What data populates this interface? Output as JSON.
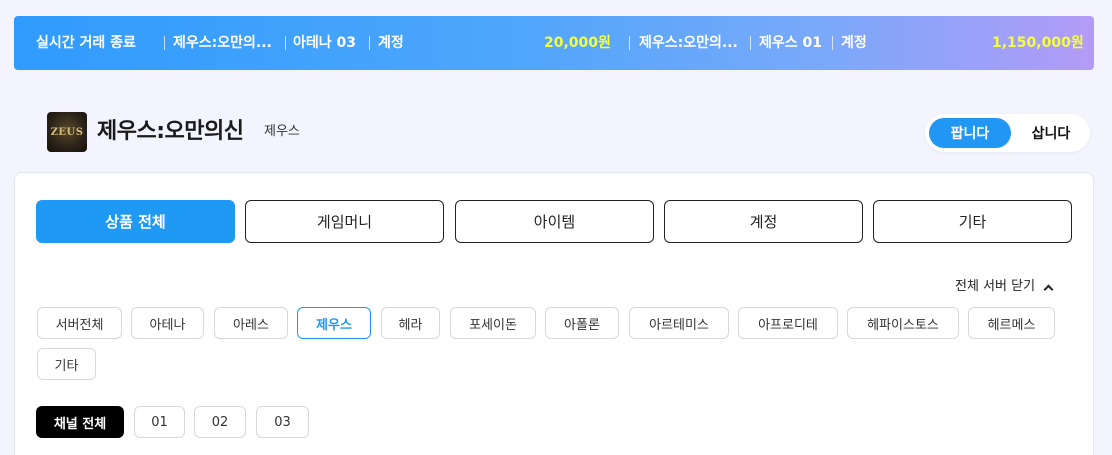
{
  "ticker": {
    "label": "실시간 거래 종료",
    "items": [
      {
        "game": "제우스:오만의...",
        "server": "아테나 03",
        "type": "계정",
        "price": "20,000원"
      },
      {
        "game": "제우스:오만의...",
        "server": "제우스 01",
        "type": "계정",
        "price": "1,150,000원"
      }
    ],
    "accent_color": "#f5ff3a"
  },
  "game": {
    "logo_icon": "zeus-logo",
    "logo_text": "ZEUS",
    "title": "제우스:오만의신",
    "subtitle": "제우스"
  },
  "trade_toggle": {
    "sell": "팝니다",
    "buy": "삽니다",
    "selected": "팝니다"
  },
  "categories": [
    "상품 전체",
    "게임머니",
    "아이템",
    "계정",
    "기타"
  ],
  "selected_category": "상품 전체",
  "server_filter": {
    "collapse_label": "전체 서버 닫기",
    "servers": [
      "서버전체",
      "아테나",
      "아레스",
      "제우스",
      "헤라",
      "포세이돈",
      "아폴론",
      "아르테미스",
      "아프로디테",
      "헤파이스토스",
      "헤르메스",
      "기타"
    ],
    "selected": "제우스"
  },
  "channel_filter": {
    "channels": [
      "채널 전체",
      "01",
      "02",
      "03"
    ],
    "selected": "채널 전체"
  },
  "colors": {
    "primary": "#1e9af5",
    "background": "#f3f4fd"
  }
}
